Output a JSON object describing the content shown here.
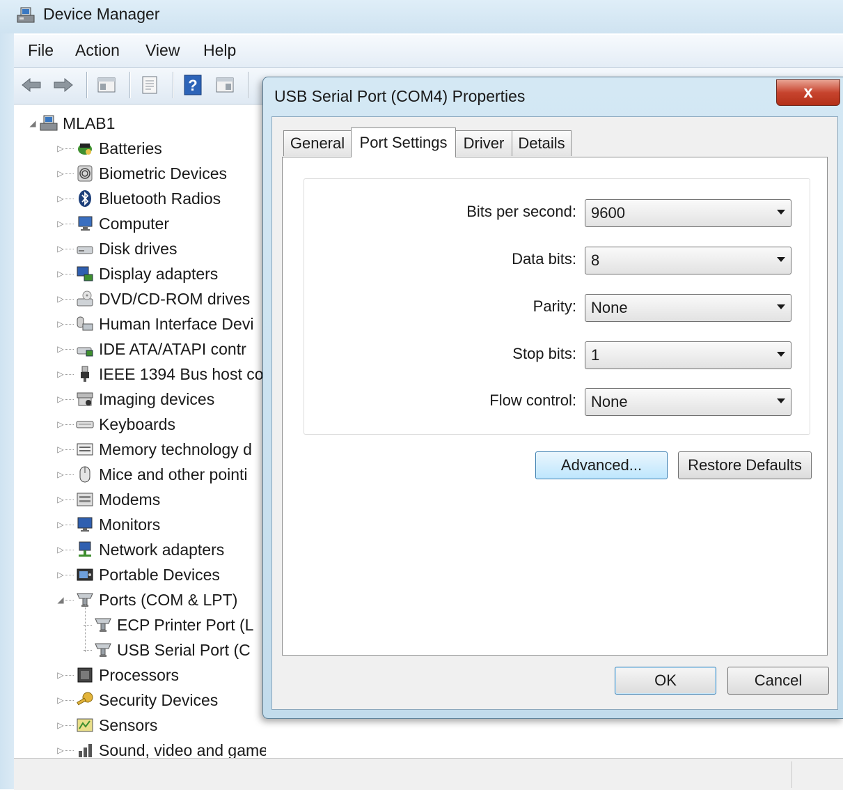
{
  "window": {
    "title": "Device Manager"
  },
  "menu": [
    "File",
    "Action",
    "View",
    "Help"
  ],
  "toolbar": {
    "buttons": [
      "back-arrow-icon",
      "forward-arrow-icon",
      "properties-pane-icon",
      "properties-icon",
      "help-icon",
      "console-tree-icon"
    ]
  },
  "tree": {
    "root": "MLAB1",
    "items": [
      {
        "label": "Batteries",
        "icon": "battery-icon",
        "expanded": false
      },
      {
        "label": "Biometric Devices",
        "icon": "fingerprint-icon",
        "expanded": false
      },
      {
        "label": "Bluetooth Radios",
        "icon": "bluetooth-icon",
        "expanded": false
      },
      {
        "label": "Computer",
        "icon": "computer-icon",
        "expanded": false
      },
      {
        "label": "Disk drives",
        "icon": "disk-drive-icon",
        "expanded": false
      },
      {
        "label": "Display adapters",
        "icon": "display-adapter-icon",
        "expanded": false
      },
      {
        "label": "DVD/CD-ROM drives",
        "icon": "dvd-drive-icon",
        "expanded": false
      },
      {
        "label": "Human Interface Devi",
        "icon": "hid-icon",
        "expanded": false
      },
      {
        "label": "IDE ATA/ATAPI contr",
        "icon": "ide-controller-icon",
        "expanded": false
      },
      {
        "label": "IEEE 1394 Bus host co",
        "icon": "ieee1394-icon",
        "expanded": false
      },
      {
        "label": "Imaging devices",
        "icon": "imaging-icon",
        "expanded": false
      },
      {
        "label": "Keyboards",
        "icon": "keyboard-icon",
        "expanded": false
      },
      {
        "label": "Memory technology d",
        "icon": "memory-icon",
        "expanded": false
      },
      {
        "label": "Mice and other pointi",
        "icon": "mouse-icon",
        "expanded": false
      },
      {
        "label": "Modems",
        "icon": "modem-icon",
        "expanded": false
      },
      {
        "label": "Monitors",
        "icon": "monitor-icon",
        "expanded": false
      },
      {
        "label": "Network adapters",
        "icon": "network-adapter-icon",
        "expanded": false
      },
      {
        "label": "Portable Devices",
        "icon": "portable-device-icon",
        "expanded": false
      },
      {
        "label": "Ports (COM & LPT)",
        "icon": "port-icon",
        "expanded": true
      },
      {
        "label": "ECP Printer Port (L",
        "icon": "port-icon",
        "child": true
      },
      {
        "label": "USB Serial Port (C",
        "icon": "port-icon",
        "child": true
      },
      {
        "label": "Processors",
        "icon": "processor-icon",
        "expanded": false
      },
      {
        "label": "Security Devices",
        "icon": "security-key-icon",
        "expanded": false
      },
      {
        "label": "Sensors",
        "icon": "sensor-icon",
        "expanded": false
      },
      {
        "label": "Sound, video and game controllers",
        "icon": "sound-icon",
        "expanded": false
      }
    ]
  },
  "dialog": {
    "title": "USB Serial Port (COM4) Properties",
    "close_label": "x",
    "tabs": [
      "General",
      "Port Settings",
      "Driver",
      "Details"
    ],
    "active_tab": "Port Settings",
    "fields": [
      {
        "label": "Bits per second:",
        "value": "9600"
      },
      {
        "label": "Data bits:",
        "value": "8"
      },
      {
        "label": "Parity:",
        "value": "None"
      },
      {
        "label": "Stop bits:",
        "value": "1"
      },
      {
        "label": "Flow control:",
        "value": "None"
      }
    ],
    "advanced_label": "Advanced...",
    "restore_label": "Restore Defaults",
    "ok_label": "OK",
    "cancel_label": "Cancel"
  }
}
